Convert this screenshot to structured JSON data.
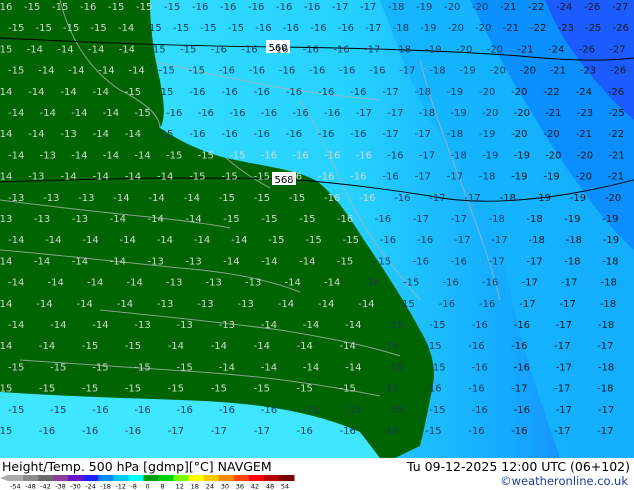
{
  "footer": {
    "title": "Height/Temp. 500 hPa [gdmp][°C] NAVGEM",
    "datetime": "Tu 09-12-2025 12:00 UTC (06+102)",
    "credit": "©weatheronline.co.uk"
  },
  "legend": {
    "ticks": [
      "-54",
      "-48",
      "-42",
      "-38",
      "-30",
      "-24",
      "-18",
      "-12",
      "-8",
      "0",
      "8",
      "12",
      "18",
      "24",
      "30",
      "36",
      "42",
      "48",
      "54"
    ],
    "colors": [
      "#aaaaaa",
      "#8a8a8a",
      "#6a6a6a",
      "#8c3ca0",
      "#6a14c8",
      "#1e1eff",
      "#008cff",
      "#00c8ff",
      "#00ffff",
      "#00a000",
      "#00d200",
      "#78ff00",
      "#ffff00",
      "#ffc800",
      "#ff8c00",
      "#ff4600",
      "#ff0000",
      "#b40000",
      "#780000"
    ]
  },
  "map": {
    "colors": {
      "land": "#006400",
      "sea": "#3ee6ff",
      "isotherm": "#aab4b4",
      "height_contour": "#000000",
      "label_green": "#2b2b2b",
      "label_cyan": "#1b3a55",
      "label_blue": "#1a1a1a"
    },
    "height_contours": [
      {
        "value": "560"
      },
      {
        "value": "568"
      }
    ],
    "temperature_labels": [
      "-16",
      "-15",
      "-15",
      "-16",
      "-15",
      "-15",
      "-15",
      "-16",
      "-16",
      "-16",
      "-16",
      "-16",
      "-17",
      "-17",
      "-18",
      "-19",
      "-20",
      "-20",
      "-21",
      "-22",
      "-24",
      "-26",
      "-27",
      "-15",
      "-15",
      "-15",
      "-15",
      "-14",
      "-15",
      "-15",
      "-15",
      "-15",
      "-16",
      "-16",
      "-16",
      "-16",
      "-17",
      "-18",
      "-19",
      "-20",
      "-20",
      "-21",
      "-22",
      "-23",
      "-25",
      "-26",
      "-15",
      "-14",
      "-14",
      "-14",
      "-14",
      "-15",
      "-15",
      "-16",
      "-16",
      "-16",
      "-16",
      "-16",
      "-17",
      "-18",
      "-19",
      "-20",
      "-20",
      "-21",
      "-24",
      "-26",
      "-27",
      "-15",
      "-14",
      "-14",
      "-14",
      "-14",
      "-15",
      "-15",
      "-16",
      "-16",
      "-16",
      "-16",
      "-16",
      "-16",
      "-17",
      "-18",
      "-19",
      "-20",
      "-20",
      "-21",
      "-23",
      "-26",
      "-14",
      "-14",
      "-14",
      "-14",
      "-15",
      "-15",
      "-16",
      "-16",
      "-16",
      "-16",
      "-16",
      "-16",
      "-17",
      "-18",
      "-19",
      "-20",
      "-20",
      "-22",
      "-24",
      "-26",
      "-14",
      "-14",
      "-14",
      "-14",
      "-15",
      "-16",
      "-16",
      "-16",
      "-16",
      "-16",
      "-16",
      "-17",
      "-17",
      "-18",
      "-19",
      "-20",
      "-20",
      "-21",
      "-23",
      "-25",
      "-14",
      "-14",
      "-13",
      "-14",
      "-14",
      "-15",
      "-16",
      "-16",
      "-16",
      "-16",
      "-16",
      "-16",
      "-17",
      "-17",
      "-18",
      "-19",
      "-20",
      "-20",
      "-21",
      "-22",
      "-14",
      "-13",
      "-14",
      "-14",
      "-14",
      "-15",
      "-15",
      "-15",
      "-16",
      "-16",
      "-16",
      "-16",
      "-16",
      "-17",
      "-18",
      "-19",
      "-19",
      "-20",
      "-20",
      "-21",
      "-14",
      "-13",
      "-14",
      "-14",
      "-14",
      "-14",
      "-15",
      "-15",
      "-15",
      "-16",
      "-16",
      "-16",
      "-16",
      "-17",
      "-17",
      "-18",
      "-19",
      "-19",
      "-20",
      "-21",
      "-13",
      "-13",
      "-13",
      "-14",
      "-14",
      "-14",
      "-15",
      "-15",
      "-15",
      "-16",
      "-16",
      "-16",
      "-17",
      "-17",
      "-18",
      "-19",
      "-19",
      "-20",
      "-13",
      "-13",
      "-13",
      "-14",
      "-14",
      "-14",
      "-15",
      "-15",
      "-15",
      "-16",
      "-16",
      "-17",
      "-17",
      "-18",
      "-18",
      "-19",
      "-19",
      "-14",
      "-14",
      "-14",
      "-14",
      "-14",
      "-14",
      "-14",
      "-15",
      "-15",
      "-15",
      "-16",
      "-16",
      "-17",
      "-17",
      "-18",
      "-18",
      "-19",
      "-14",
      "-14",
      "-14",
      "-14",
      "-13",
      "-13",
      "-14",
      "-14",
      "-14",
      "-15",
      "-15",
      "-16",
      "-16",
      "-17",
      "-17",
      "-18",
      "-18",
      "-14",
      "-14",
      "-14",
      "-14",
      "-13",
      "-13",
      "-13",
      "-14",
      "-14",
      "-14",
      "-15",
      "-16",
      "-16",
      "-17",
      "-17",
      "-18",
      "-14",
      "-14",
      "-14",
      "-14",
      "-13",
      "-13",
      "-13",
      "-14",
      "-14",
      "-14",
      "-15",
      "-16",
      "-16",
      "-17",
      "-17",
      "-18",
      "-14",
      "-14",
      "-14",
      "-13",
      "-13",
      "-13",
      "-14",
      "-14",
      "-14",
      "-15",
      "-15",
      "-16",
      "-16",
      "-17",
      "-18",
      "-14",
      "-14",
      "-15",
      "-15",
      "-14",
      "-14",
      "-14",
      "-14",
      "-14",
      "-15",
      "-15",
      "-16",
      "-16",
      "-17",
      "-17",
      "-15",
      "-15",
      "-15",
      "-15",
      "-15",
      "-14",
      "-14",
      "-14",
      "-14",
      "-15",
      "-15",
      "-16",
      "-16",
      "-17",
      "-18",
      "-15",
      "-15",
      "-15",
      "-15",
      "-15",
      "-15",
      "-15",
      "-15",
      "-15",
      "-15",
      "-16",
      "-16",
      "-17",
      "-17",
      "-18",
      "-15",
      "-15",
      "-16",
      "-16",
      "-16",
      "-16",
      "-16",
      "-15",
      "-15",
      "-15",
      "-15",
      "-16",
      "-16",
      "-17",
      "-17",
      "-15",
      "-16",
      "-16",
      "-16",
      "-17",
      "-17",
      "-17",
      "-16",
      "-16",
      "-16",
      "-15",
      "-16",
      "-16",
      "-17",
      "-17"
    ]
  }
}
